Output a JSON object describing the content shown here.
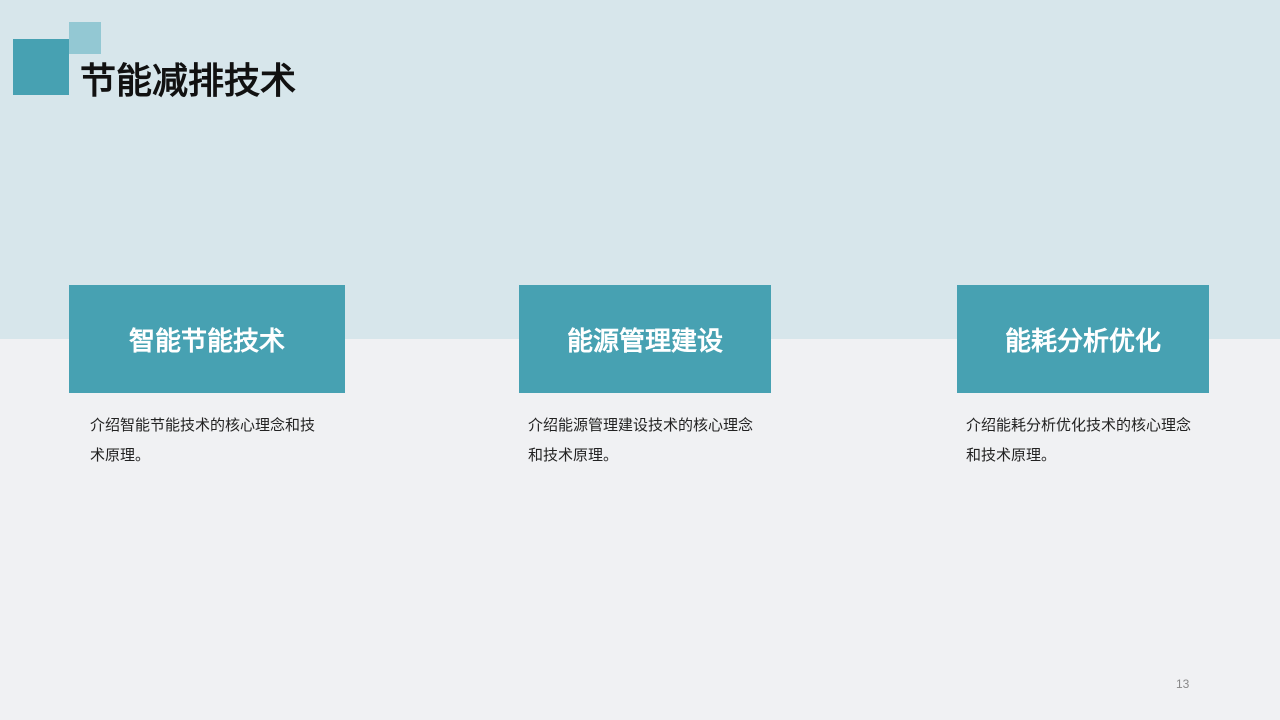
{
  "slide": {
    "title": "节能减排技术",
    "page_number": "13"
  },
  "cards": [
    {
      "heading": "智能节能技术",
      "description": "介绍智能节能技术的核心理念和技术原理。"
    },
    {
      "heading": "能源管理建设",
      "description": "介绍能源管理建设技术的核心理念和技术原理。"
    },
    {
      "heading": "能耗分析优化",
      "description": "介绍能耗分析优化技术的核心理念和技术原理。"
    }
  ],
  "colors": {
    "accent": "#47a1b2",
    "accent_light": "#93c8d3",
    "top_band": "#d7e6eb",
    "bottom_band": "#f0f1f3"
  }
}
